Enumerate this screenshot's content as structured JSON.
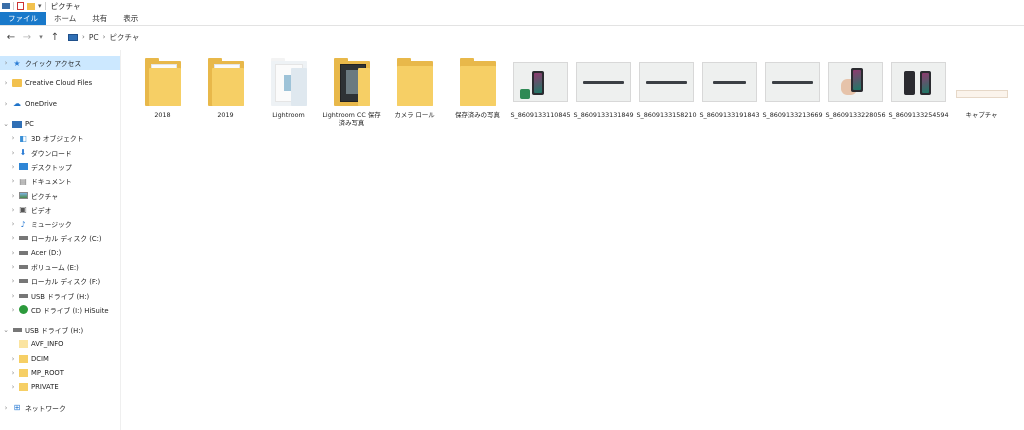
{
  "window": {
    "title": "ピクチャ"
  },
  "ribbon": {
    "tabs": [
      "ファイル",
      "ホーム",
      "共有",
      "表示"
    ]
  },
  "address": {
    "path": [
      "PC",
      "ピクチャ"
    ]
  },
  "nav": {
    "quick_access": "クイック アクセス",
    "creative_cloud": "Creative Cloud Files",
    "onedrive": "OneDrive",
    "pc": "PC",
    "pc_items": [
      "3D オブジェクト",
      "ダウンロード",
      "デスクトップ",
      "ドキュメント",
      "ピクチャ",
      "ビデオ",
      "ミュージック",
      "ローカル ディスク (C:)",
      "Acer (D:)",
      "ボリューム (E:)",
      "ローカル ディスク (F:)",
      "USB ドライブ (H:)",
      "CD ドライブ (I:) HiSuite"
    ],
    "usb": "USB ドライブ (H:)",
    "usb_items": [
      "AVF_INFO",
      "DCIM",
      "MP_ROOT",
      "PRIVATE"
    ],
    "network": "ネットワーク"
  },
  "files": [
    {
      "name": "2018",
      "kind": "folder-docs"
    },
    {
      "name": "2019",
      "kind": "folder-docs"
    },
    {
      "name": "Lightroom",
      "kind": "folder-lr"
    },
    {
      "name": "Lightroom CC 保存済み写真",
      "kind": "folder-lr-dark"
    },
    {
      "name": "カメラ ロール",
      "kind": "folder"
    },
    {
      "name": "保存済みの写真",
      "kind": "folder"
    },
    {
      "name": "S_8609133110845",
      "kind": "photo-phone-green"
    },
    {
      "name": "S_8609133131849",
      "kind": "photo-bar"
    },
    {
      "name": "S_8609133158210",
      "kind": "photo-bar"
    },
    {
      "name": "S_8609133191843",
      "kind": "photo-bar"
    },
    {
      "name": "S_8609133213669",
      "kind": "photo-bar"
    },
    {
      "name": "S_8609133228056",
      "kind": "photo-hand"
    },
    {
      "name": "S_8609133254594",
      "kind": "photo-two-phones"
    },
    {
      "name": "キャプチャ",
      "kind": "capture"
    }
  ],
  "colors": {
    "accent": "#1979ca",
    "selected": "#cce8ff",
    "folder": "#f6cf65"
  }
}
